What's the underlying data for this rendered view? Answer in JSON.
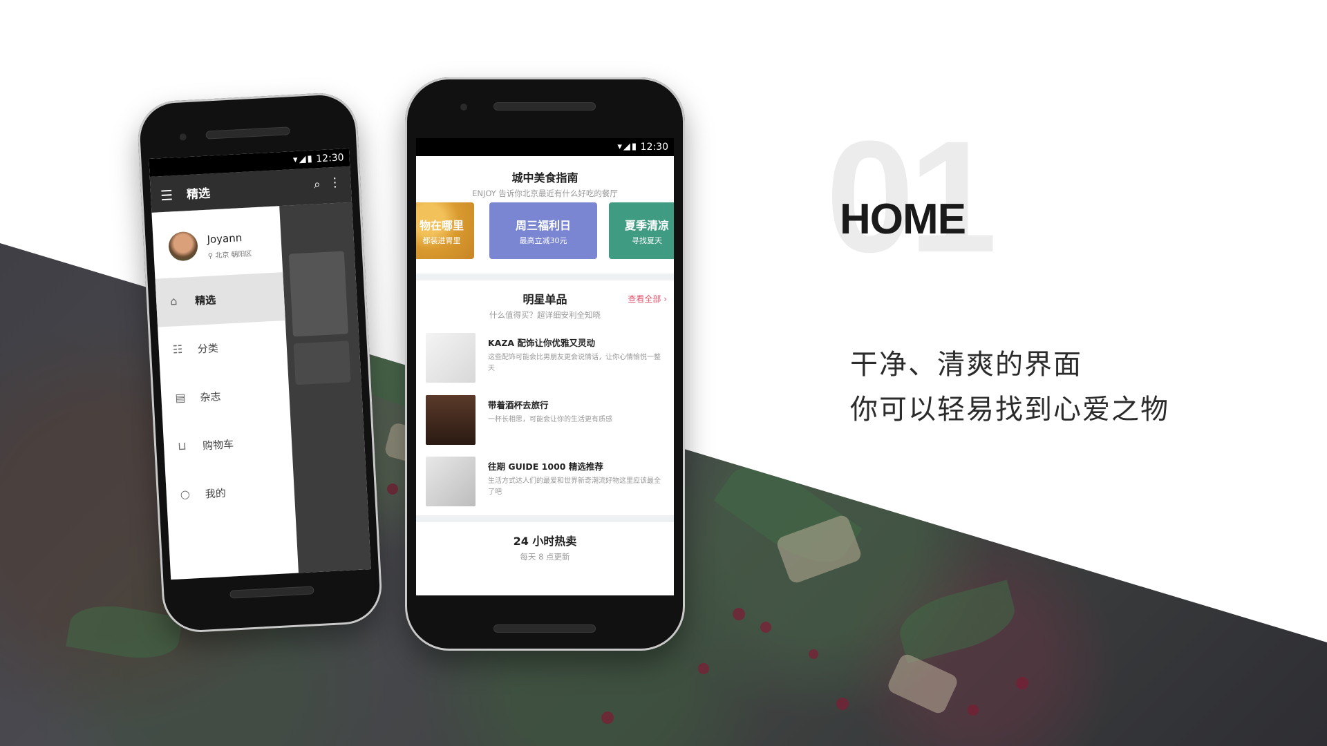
{
  "slide": {
    "number": "01",
    "title": "HOME",
    "tagline_line1": "干净、清爽的界面",
    "tagline_line2": "你可以轻易找到心爱之物"
  },
  "left_phone": {
    "status_time": "12:30",
    "toolbar_title": "精选",
    "profile": {
      "name": "Joyann",
      "location": "北京 朝阳区"
    },
    "menu": [
      {
        "icon": "home-icon",
        "label": "精选",
        "active": true
      },
      {
        "icon": "category-icon",
        "label": "分类",
        "active": false
      },
      {
        "icon": "magazine-icon",
        "label": "杂志",
        "active": false
      },
      {
        "icon": "cart-icon",
        "label": "购物车",
        "active": false
      },
      {
        "icon": "user-icon",
        "label": "我的",
        "active": false
      }
    ]
  },
  "right_phone": {
    "status_time": "12:30",
    "guide": {
      "title": "城中美食指南",
      "subtitle": "ENJOY 告诉你北京最近有什么好吃的餐厅",
      "banners": [
        {
          "title": "物在哪里",
          "subtitle": "都装进胃里",
          "color": "#d99a2f"
        },
        {
          "title": "周三福利日",
          "subtitle": "最高立减30元",
          "color": "#7a86d2"
        },
        {
          "title": "夏季清凉",
          "subtitle": "寻找夏天",
          "color": "#3f9c82"
        }
      ]
    },
    "featured": {
      "title": "明星单品",
      "subtitle": "什么值得买？超详细安利全知晓",
      "view_all": "查看全部 ›",
      "items": [
        {
          "title": "KAZA 配饰让你优雅又灵动",
          "desc": "这些配饰可能会比男朋友更会说情话，让你心情愉悦一整天"
        },
        {
          "title": "带着酒杯去旅行",
          "desc": "一杯长相思，可能会让你的生活更有质感"
        },
        {
          "title": "往期 GUIDE 1000 精选推荐",
          "desc": "生活方式达人们的最爱和世界新奇潮流好物这里应该最全了吧"
        }
      ]
    },
    "hot": {
      "title": "24 小时热卖",
      "subtitle": "每天 8 点更新"
    }
  },
  "colors": {
    "accent": "#e4536c",
    "toolbar": "#2f2f2f",
    "drawer_active": "#e3e3e3"
  }
}
